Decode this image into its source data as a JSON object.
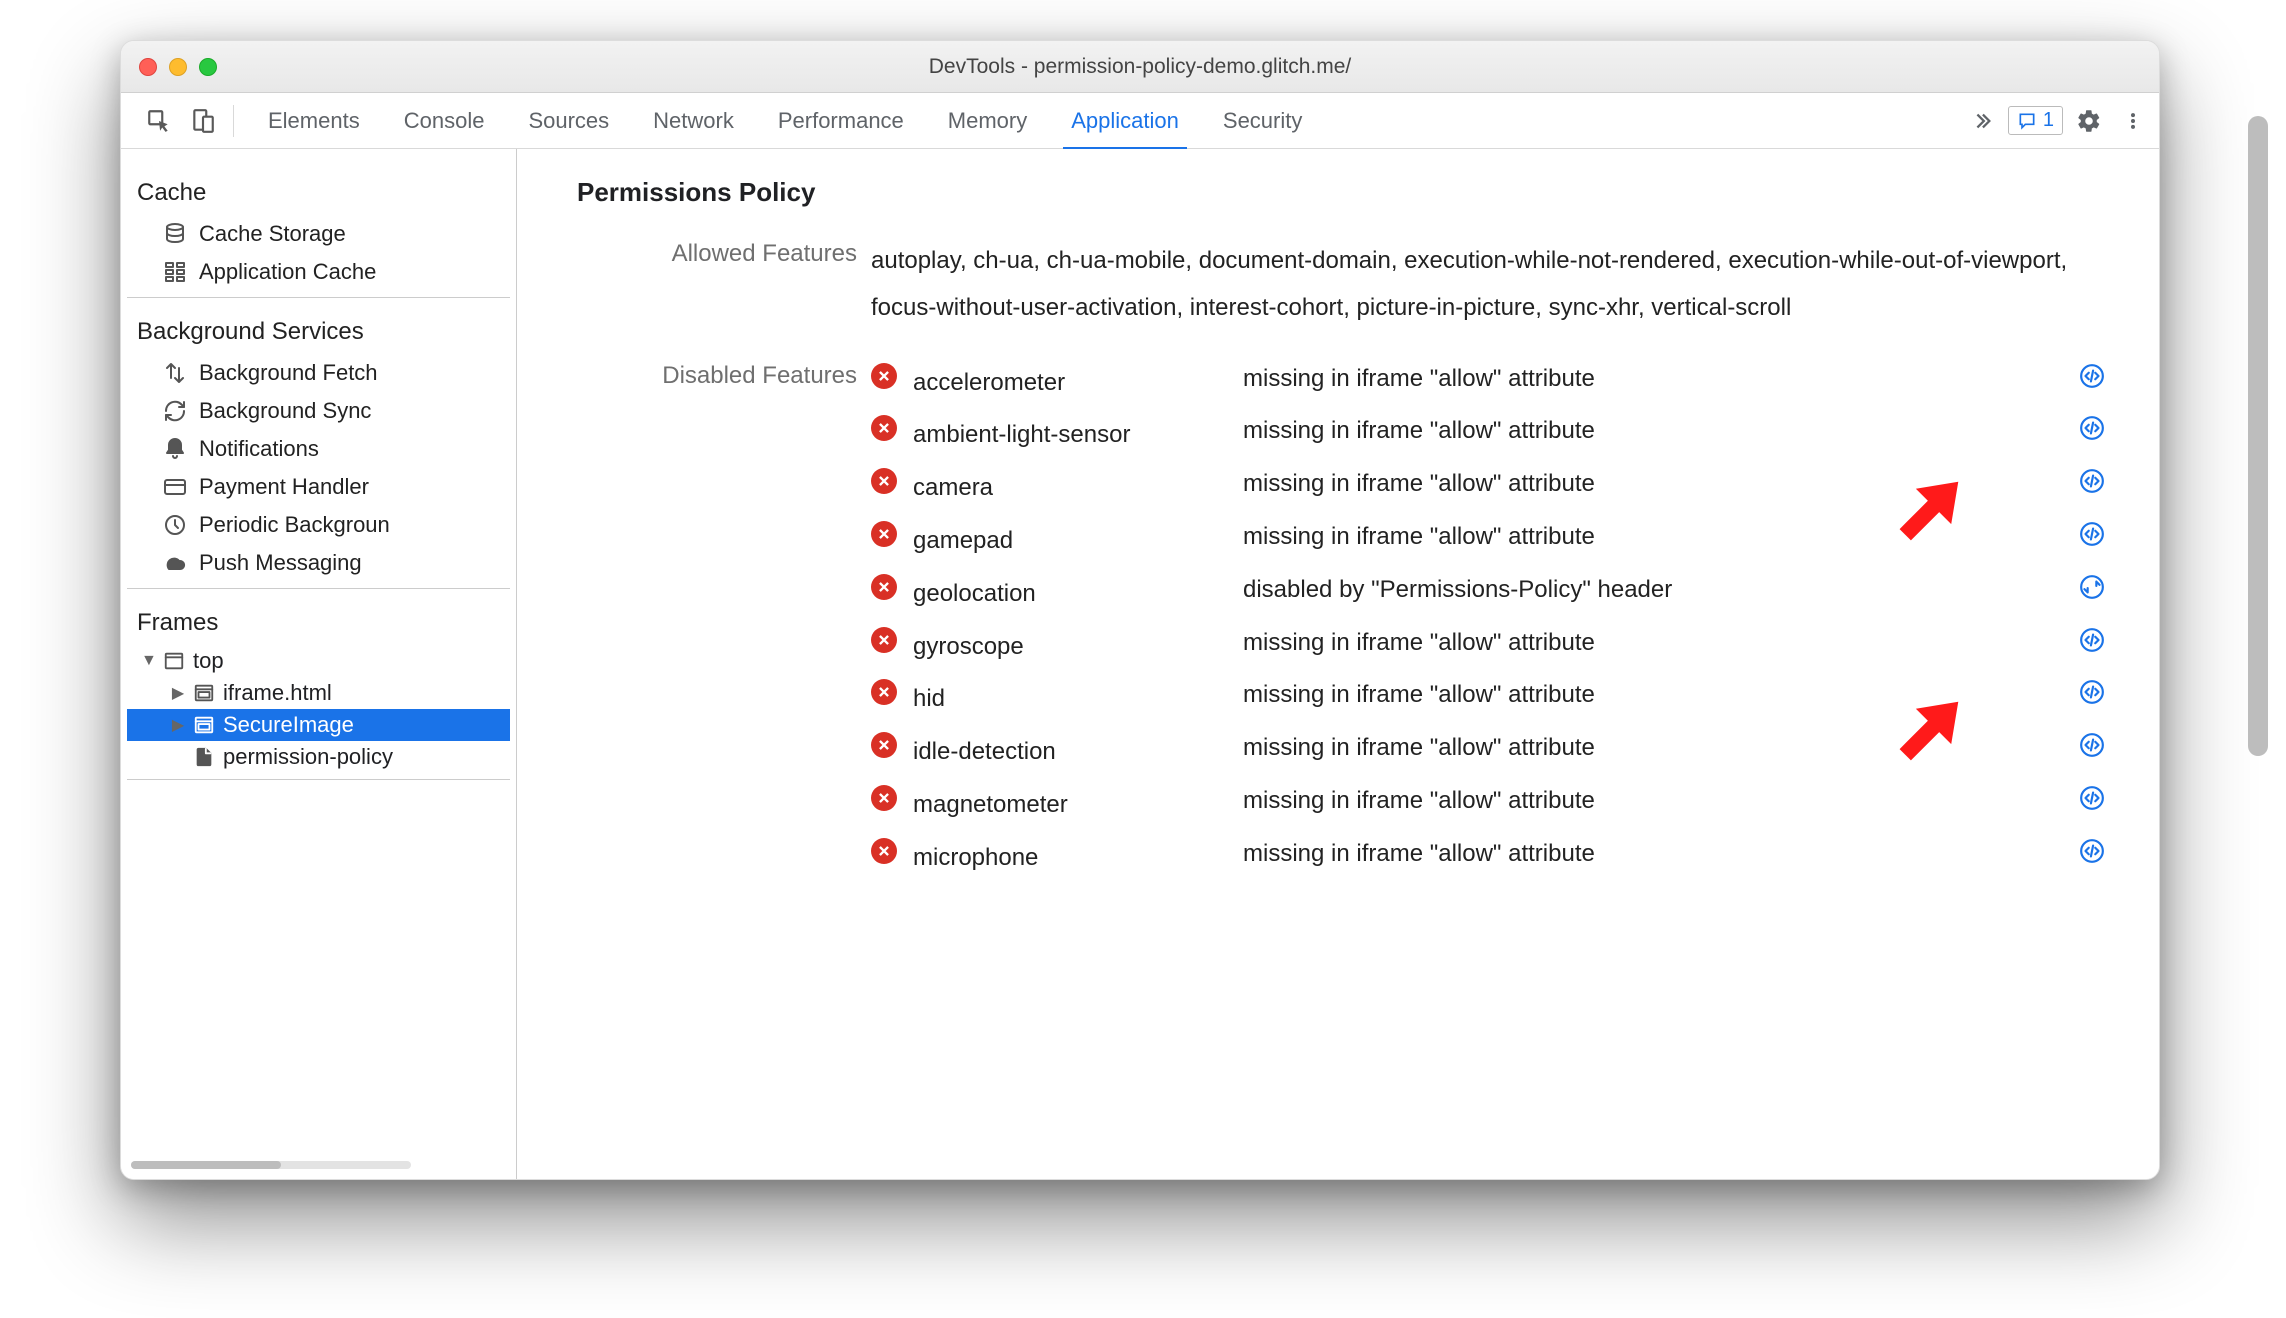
{
  "window": {
    "title": "DevTools - permission-policy-demo.glitch.me/"
  },
  "toolbar": {
    "tabs": [
      "Elements",
      "Console",
      "Sources",
      "Network",
      "Performance",
      "Memory",
      "Application",
      "Security"
    ],
    "active_tab": "Application",
    "issues_count": "1"
  },
  "sidebar": {
    "sections": [
      {
        "heading": "Cache",
        "items": [
          {
            "id": "cache-storage",
            "label": "Cache Storage",
            "icon": "database"
          },
          {
            "id": "application-cache",
            "label": "Application Cache",
            "icon": "grid"
          }
        ]
      },
      {
        "heading": "Background Services",
        "items": [
          {
            "id": "bg-fetch",
            "label": "Background Fetch",
            "icon": "updown"
          },
          {
            "id": "bg-sync",
            "label": "Background Sync",
            "icon": "refresh"
          },
          {
            "id": "notifications",
            "label": "Notifications",
            "icon": "bell"
          },
          {
            "id": "payment-handler",
            "label": "Payment Handler",
            "icon": "card"
          },
          {
            "id": "periodic-bg",
            "label": "Periodic Backgroun",
            "icon": "clock"
          },
          {
            "id": "push-messaging",
            "label": "Push Messaging",
            "icon": "cloud"
          }
        ]
      },
      {
        "heading": "Frames",
        "tree": {
          "label": "top",
          "icon": "window",
          "expanded": true,
          "children": [
            {
              "label": "iframe.html",
              "icon": "frame",
              "expandable": true
            },
            {
              "label": "SecureImage",
              "icon": "frame",
              "expandable": true,
              "selected": true
            },
            {
              "label": "permission-policy",
              "icon": "file",
              "expandable": false
            }
          ]
        }
      }
    ]
  },
  "main": {
    "title": "Permissions Policy",
    "allowed_label": "Allowed Features",
    "allowed_text": "autoplay, ch-ua, ch-ua-mobile, document-domain, execution-while-not-rendered, execution-while-out-of-viewport, focus-without-user-activation, interest-cohort, picture-in-picture, sync-xhr, vertical-scroll",
    "disabled_label": "Disabled Features",
    "disabled": [
      {
        "name": "accelerometer",
        "reason": "missing in iframe \"allow\" attribute",
        "link": "code"
      },
      {
        "name": "ambient-light-sensor",
        "reason": "missing in iframe \"allow\" attribute",
        "link": "code"
      },
      {
        "name": "camera",
        "reason": "missing in iframe \"allow\" attribute",
        "link": "code"
      },
      {
        "name": "gamepad",
        "reason": "missing in iframe \"allow\" attribute",
        "link": "code"
      },
      {
        "name": "geolocation",
        "reason": "disabled by \"Permissions-Policy\" header",
        "link": "net"
      },
      {
        "name": "gyroscope",
        "reason": "missing in iframe \"allow\" attribute",
        "link": "code"
      },
      {
        "name": "hid",
        "reason": "missing in iframe \"allow\" attribute",
        "link": "code"
      },
      {
        "name": "idle-detection",
        "reason": "missing in iframe \"allow\" attribute",
        "link": "code"
      },
      {
        "name": "magnetometer",
        "reason": "missing in iframe \"allow\" attribute",
        "link": "code"
      },
      {
        "name": "microphone",
        "reason": "missing in iframe \"allow\" attribute",
        "link": "code"
      }
    ]
  }
}
